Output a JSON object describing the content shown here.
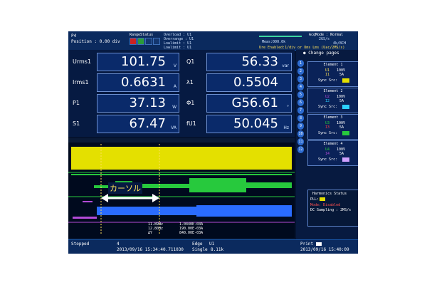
{
  "header": {
    "left1": "P4",
    "left2": "Position : 0.00 div",
    "range_status": "RangeStatus",
    "range_lines": [
      "Overload : U1",
      "Overrange : U1",
      "Lowlimit : U1",
      "Lowlimit : U1"
    ],
    "acq_mode": "AcqMode : Normal",
    "rate": "2GS/s",
    "sample": "4k/8CH",
    "mid_small": "Meas:000.0k",
    "scale_line": "Ure Enabled:1/div or Ums Lms (Uac/2MS/s)"
  },
  "measurements": [
    {
      "label": "Urms1",
      "value": "101.75",
      "unit": "V"
    },
    {
      "label": "Irms1",
      "value": "0.6631",
      "unit": "A"
    },
    {
      "label": "P1",
      "value": "37.13",
      "unit": "W"
    },
    {
      "label": "S1",
      "value": "67.47",
      "unit": "VA"
    }
  ],
  "measurements_right": [
    {
      "label": "Q1",
      "value": "56.33",
      "unit": "var"
    },
    {
      "label": "λ1",
      "value": "0.5504",
      "unit": ""
    },
    {
      "label": "Φ1",
      "value": "G56.61",
      "unit": "°"
    },
    {
      "label": "fU1",
      "value": "50.045",
      "unit": "Hz"
    }
  ],
  "sidebar": {
    "change_pages": "Change pages",
    "page_numbers": [
      "1",
      "2",
      "3",
      "4",
      "5",
      "6",
      "7",
      "8",
      "9",
      "10",
      "11",
      "12"
    ],
    "elements": [
      {
        "title": "Element 1",
        "u": "U1",
        "uval": "100V",
        "i": "I1",
        "ival": "5A",
        "sync": "Sync Src:"
      },
      {
        "title": "Element 2",
        "u": "U2",
        "uval": "100V",
        "i": "I2",
        "ival": "5A",
        "sync": "Sync Src:"
      },
      {
        "title": "Element 3",
        "u": "U3",
        "uval": "100V",
        "i": "I3",
        "ival": "5A",
        "sync": "Sync Src:"
      },
      {
        "title": "Element 4",
        "u": "U4",
        "uval": "100V",
        "i": "I4",
        "ival": "5A",
        "sync": "Sync Src:"
      }
    ],
    "harmonics_title": "Harmonics Status",
    "harmonics_pll": "PLL:",
    "harmonics_mode": "Mode: Disabled",
    "harmonics_sampling": "DC Sampling : 2MS/s"
  },
  "waveform": {
    "cursor_label": "カーソル",
    "readout": [
      {
        "k": "11.89Hz",
        "v": "1.0440E-03A"
      },
      {
        "k": "12.80Hz",
        "v": "190.00E-03A"
      },
      {
        "k": "ΔY",
        "v": "840.00E-03A"
      }
    ],
    "colors": {
      "yellow": "#e4e000",
      "green": "#27c93d",
      "blue": "#2a6cff",
      "purple": "#b24bd7"
    }
  },
  "status": {
    "left": "Stopped",
    "center_count": "4",
    "center_datetime": "2013/09/16 15:34:40.711030",
    "edge": "Edge",
    "edge_src": "U1",
    "single": "Single",
    "time": "8.11k",
    "print": "Print",
    "right_datetime": "2013/09/16  15:40:09"
  }
}
